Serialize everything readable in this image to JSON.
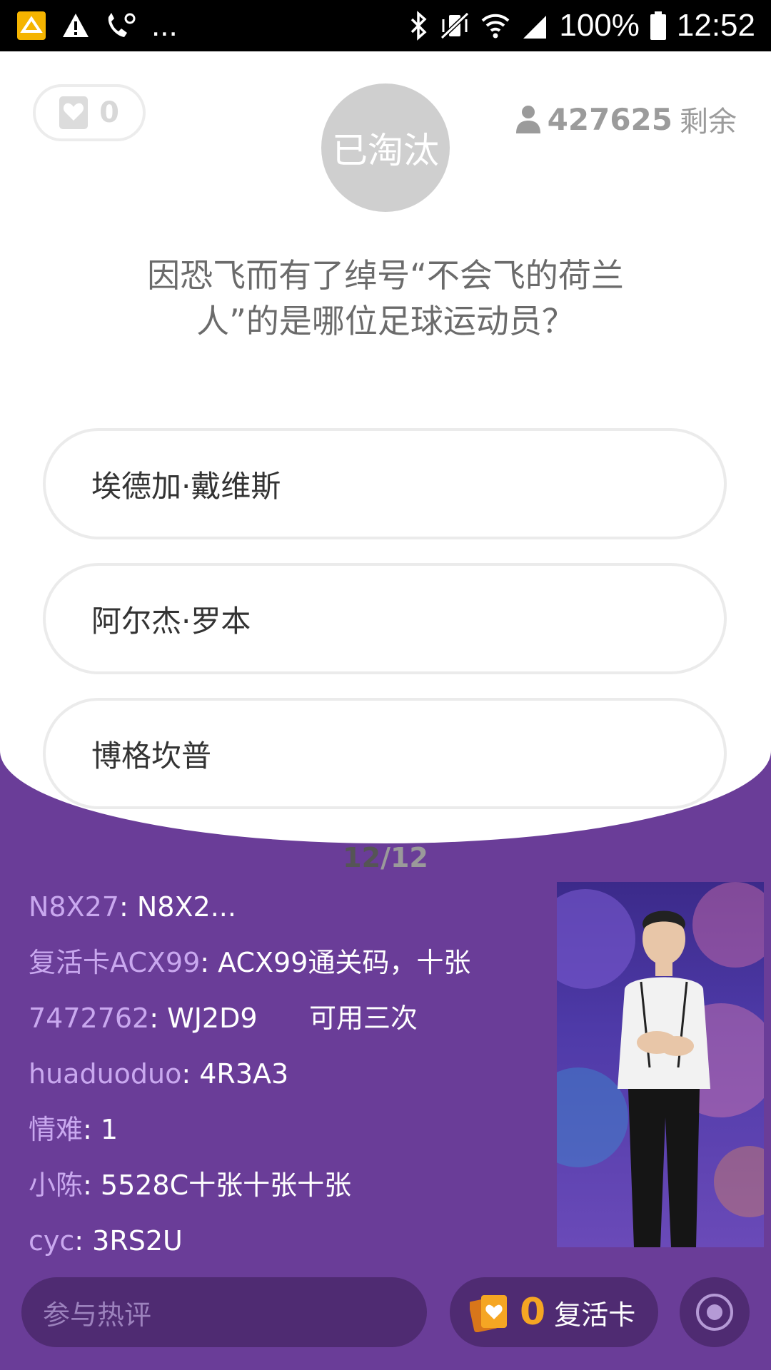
{
  "status_bar": {
    "ellipsis": "...",
    "battery": "100%",
    "time": "12:52"
  },
  "quiz": {
    "lives": "0",
    "status": "已淘汰",
    "remaining_count": "427625",
    "remaining_label": "剩余",
    "question": "因恐飞而有了绰号“不会飞的荷兰人”的是哪位足球运动员？",
    "options": [
      {
        "label": "埃德加·戴维斯"
      },
      {
        "label": "阿尔杰·罗本"
      },
      {
        "label": "博格坎普"
      }
    ],
    "progress_current": "12",
    "progress_sep_total": "/12"
  },
  "comments": [
    {
      "user": "N8X27",
      "text": ": N8X2..."
    },
    {
      "user": "复活卡ACX99",
      "text": ": ACX99通关码，十张"
    },
    {
      "user": "7472762",
      "text": ": WJ2D9      可用三次"
    },
    {
      "user": "huaduoduo",
      "text": ": 4R3A3"
    },
    {
      "user": "情难",
      "text": ": 1"
    },
    {
      "user": "小陈",
      "text": ": 5528C十张十张十张"
    },
    {
      "user": "cyc",
      "text": ": 3RS2U"
    }
  ],
  "bottom_bar": {
    "comment_placeholder": "参与热评",
    "revive_count": "0",
    "revive_label": "复活卡"
  },
  "colors": {
    "background": "#6a3d98",
    "username": "#c9a8ef",
    "revive_accent": "#f5a623"
  }
}
